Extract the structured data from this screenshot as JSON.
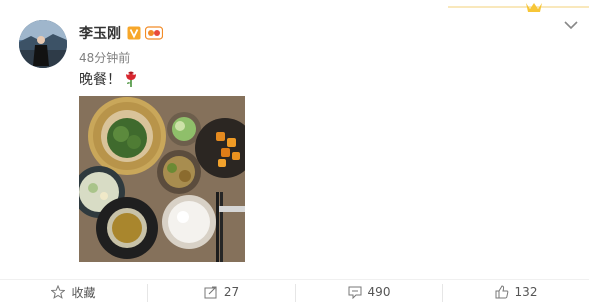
{
  "post": {
    "user_name": "李玉刚",
    "timestamp": "48分钟前",
    "text": "晚餐！",
    "image_alt": "dinner photo"
  },
  "actions": {
    "favorite_label": "收藏",
    "repost_count": "27",
    "comment_count": "490",
    "like_count": "132"
  },
  "colors": {
    "verified": "#f7a72a",
    "link": "#eb7350"
  },
  "icons": [
    "chevron-down-icon",
    "verified-v-icon",
    "level-badge-icon",
    "rose-icon",
    "star-icon",
    "repost-icon",
    "comment-icon",
    "like-icon"
  ]
}
